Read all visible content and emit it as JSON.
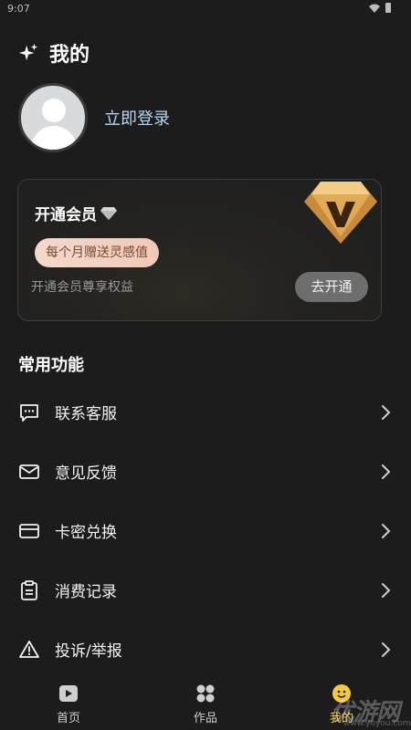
{
  "status_bar": {
    "time": "9:07"
  },
  "header": {
    "title": "我的",
    "icon": "sparkle-icon"
  },
  "profile": {
    "avatar": "avatar-icon",
    "login_label": "立即登录"
  },
  "vip_card": {
    "title": "开通会员",
    "badge": "每个月赠送灵感值",
    "description": "开通会员尊享权益",
    "button": "去开通",
    "accent": "#e8b45a"
  },
  "section": {
    "title": "常用功能"
  },
  "menu": [
    {
      "label": "联系客服",
      "icon": "chat-icon"
    },
    {
      "label": "意见反馈",
      "icon": "mail-icon"
    },
    {
      "label": "卡密兑换",
      "icon": "card-icon"
    },
    {
      "label": "消费记录",
      "icon": "clipboard-icon"
    },
    {
      "label": "投诉/举报",
      "icon": "warning-icon"
    }
  ],
  "bottom_nav": [
    {
      "label": "首页",
      "icon": "play-icon"
    },
    {
      "label": "作品",
      "icon": "grid-icon"
    },
    {
      "label": "我的",
      "icon": "emoji-icon",
      "active": true
    }
  ],
  "watermark": {
    "text": "优游网",
    "url": "www.yoyou.com"
  }
}
